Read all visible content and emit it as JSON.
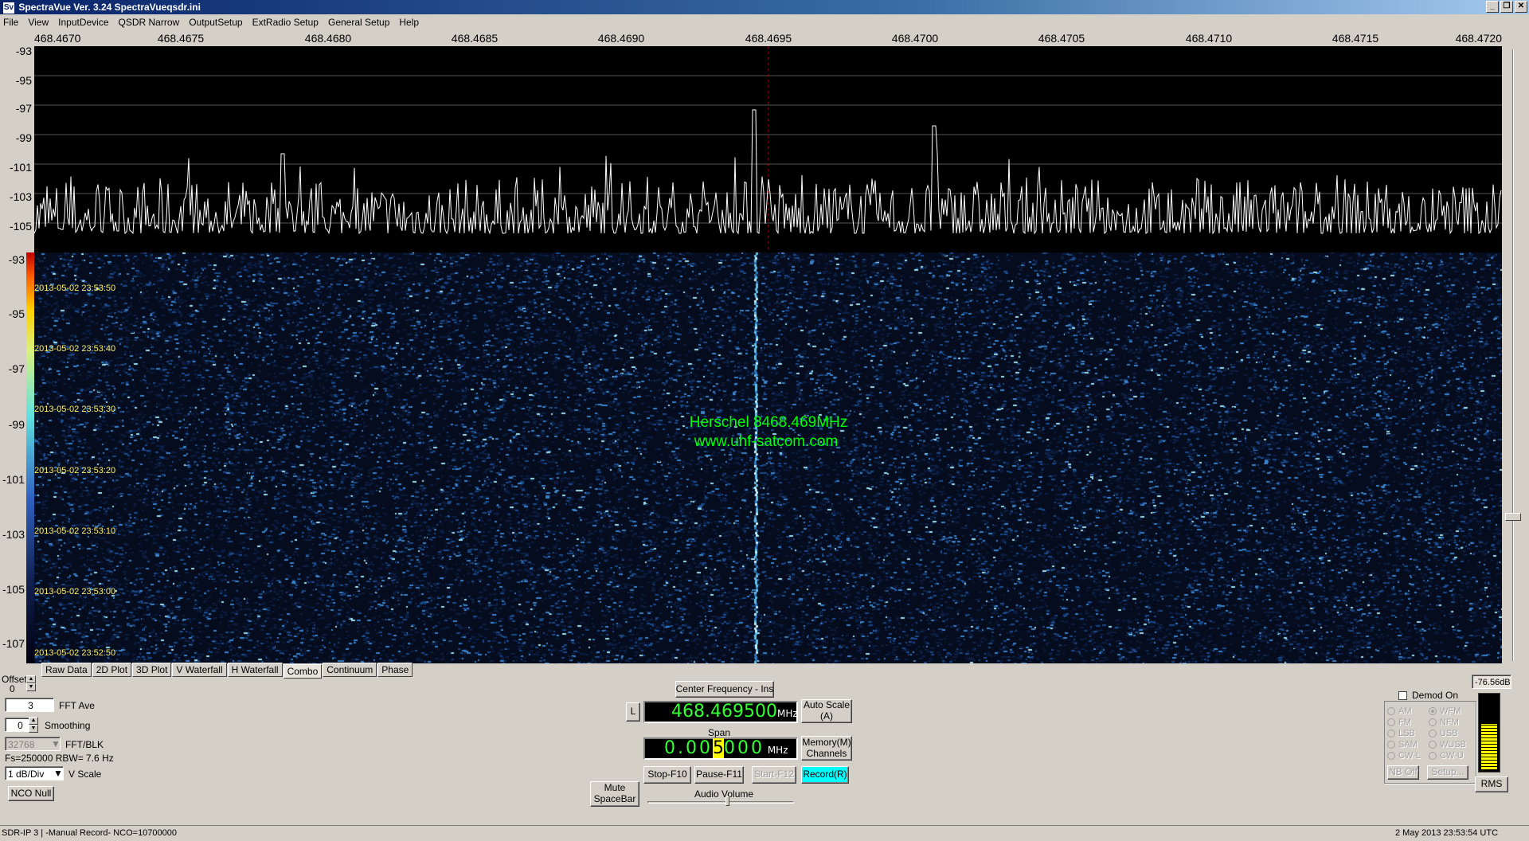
{
  "window": {
    "title": "SpectraVue Ver. 3.24  SpectraVueqsdr.ini",
    "icon_text": "Sv"
  },
  "menu": [
    "File",
    "View",
    "InputDevice",
    "QSDR Narrow",
    "OutputSetup",
    "ExtRadio Setup",
    "General Setup",
    "Help"
  ],
  "freq_axis": {
    "labels": [
      "468.4670",
      "468.4675",
      "468.4680",
      "468.4685",
      "468.4690",
      "468.4695",
      "468.4700",
      "468.4705",
      "468.4710",
      "468.4715",
      "468.4720"
    ]
  },
  "spectrum": {
    "db_labels": [
      "-93",
      "-95",
      "-97",
      "-99",
      "-101",
      "-103",
      "-105"
    ]
  },
  "waterfall": {
    "db_labels": [
      "-93",
      "-95",
      "-97",
      "-99",
      "-101",
      "-103",
      "-105",
      "-107"
    ],
    "timestamps": [
      "2013-05-02 23:53:50",
      "2013-05-02 23:53:40",
      "2013-05-02 23:53:30",
      "2013-05-02 23:53:20",
      "2013-05-02 23:53:10",
      "2013-05-02 23:53:00",
      "2013-05-02 23:52:50"
    ],
    "overlay_line1": "Herschel 8468.469MHz",
    "overlay_line2": "www.uhf-satcom.com"
  },
  "tabs": [
    "Raw Data",
    "2D Plot",
    "3D Plot",
    "V Waterfall",
    "H Waterfall",
    "Combo",
    "Continuum",
    "Phase"
  ],
  "active_tab": "Combo",
  "left_panel": {
    "offset_label": "Offset",
    "offset_value": "0",
    "fft_ave_value": "3",
    "fft_ave_label": "FFT Ave",
    "smoothing_value": "0",
    "smoothing_label": "Smoothing",
    "fft_blk_value": "32768",
    "fft_blk_label": "FFT/BLK",
    "fs_info": "Fs=250000 RBW= 7.6 Hz",
    "vscale_value": "1 dB/Div",
    "vscale_label": "V Scale",
    "nco_null_label": "NCO Null"
  },
  "center_panel": {
    "center_freq_button": "Center Frequency - Ins",
    "l_button": "L",
    "center_freq_value": "468.469500",
    "center_freq_unit": "MHz",
    "auto_scale_line1": "Auto Scale",
    "auto_scale_line2": "(A)",
    "span_label": "Span",
    "span_pre": "0.00",
    "span_hl": "5",
    "span_post": "000",
    "span_unit": "MHz",
    "memory_line1": "Memory(M)",
    "memory_line2": "Channels",
    "mute_line1": "Mute",
    "mute_line2": "SpaceBar",
    "stop_label": "Stop-F10",
    "pause_label": "Pause-F11",
    "start_label": "Start-F12",
    "record_label": "Record(R)",
    "audio_volume_label": "Audio Volume",
    "audio_volume": 0.55
  },
  "right_panel": {
    "demod_on_label": "Demod On",
    "demod_modes_left": [
      "AM",
      "FM",
      "LSB",
      "SAM",
      "CW-L"
    ],
    "demod_modes_right": [
      "WFM",
      "NFM",
      "USB",
      "WUSB",
      "CW-U"
    ],
    "selected_mode": "WFM",
    "nb_off_label": "NB Off",
    "setup_label": "Setup...",
    "level_db": "-76.56dB",
    "rms_label": "RMS",
    "meter_level": 0.62
  },
  "status": {
    "left": "SDR-IP 3  | -Manual Record-   NCO=10700000",
    "right": "2 May 2013   23:53:54 UTC"
  },
  "colors": {
    "spectrum_bg": "#000000",
    "waterfall_bg": "#040c1e",
    "overlay_text": "#00ff00",
    "timestamp_text": "#ffee66",
    "lcd_text": "#33ff33",
    "record_button": "#00ffff"
  }
}
